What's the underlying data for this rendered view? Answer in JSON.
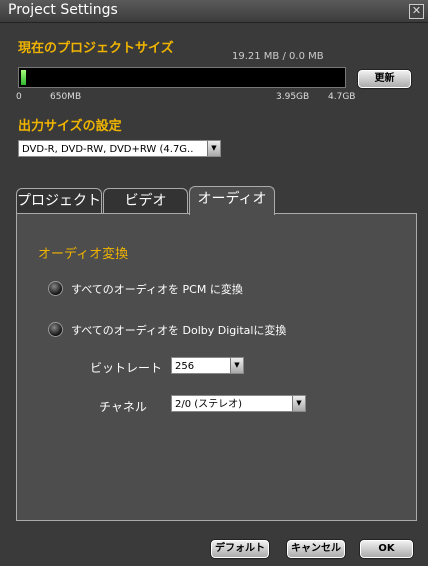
{
  "window": {
    "title": "Project Settings"
  },
  "project_size": {
    "label": "現在のプロジェクトサイズ",
    "readout": "19.21 MB  / 0.0 MB",
    "used_fraction": 0.015,
    "refresh_label": "更新",
    "scale": [
      "0",
      "650MB",
      "3.95GB",
      "4.7GB"
    ]
  },
  "output_size": {
    "label": "出力サイズの設定",
    "selected": "DVD-R, DVD-RW, DVD+RW (4.7G.."
  },
  "tabs": [
    {
      "label": "プロジェクト",
      "active": false
    },
    {
      "label": "ビデオ",
      "active": false
    },
    {
      "label": "オーディオ",
      "active": true
    }
  ],
  "audio": {
    "section_label": "オーディオ変換",
    "option_pcm": "すべてのオーディオを PCM に変換",
    "option_dolby": "すべてのオーディオを Dolby Digitalに変換",
    "bitrate_label": "ビットレート",
    "bitrate_value": "256",
    "channel_label": "チャネル",
    "channel_value": "2/0 (ステレオ)"
  },
  "footer": {
    "default_label": "デフォルト",
    "cancel_label": "キャンセル",
    "ok_label": "OK"
  }
}
